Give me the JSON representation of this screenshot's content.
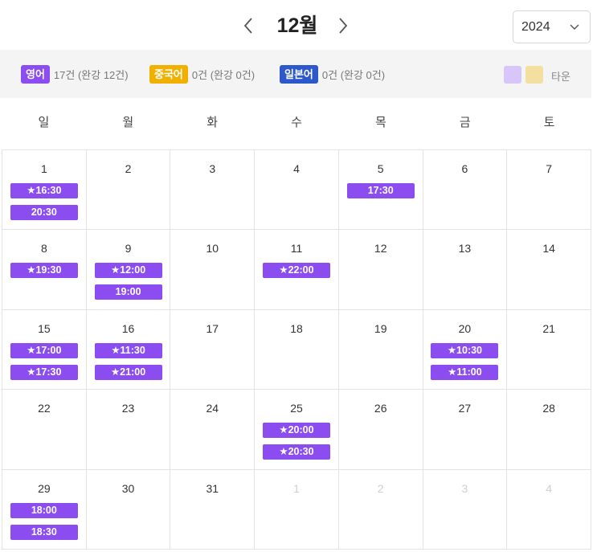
{
  "header": {
    "month": "12월",
    "year": "2024"
  },
  "colors": {
    "english": "#8b4cf0",
    "chinese": "#f0b000",
    "japanese": "#2d58cc",
    "town_light_purple": "#d8c6fb",
    "town_light_yellow": "#f3dfa0"
  },
  "legend": [
    {
      "badge": "영어",
      "count": "17건 (완강 12건)",
      "color": "#8b4cf0"
    },
    {
      "badge": "중국어",
      "count": "0건 (완강 0건)",
      "color": "#f0b000"
    },
    {
      "badge": "일본어",
      "count": "0건 (완강 0건)",
      "color": "#2d58cc"
    }
  ],
  "town_label": "타운",
  "weekdays": [
    "일",
    "월",
    "화",
    "수",
    "목",
    "금",
    "토"
  ],
  "days": [
    {
      "day": "1",
      "slots": [
        "★16:30",
        "20:30"
      ]
    },
    {
      "day": "2",
      "slots": []
    },
    {
      "day": "3",
      "slots": []
    },
    {
      "day": "4",
      "slots": []
    },
    {
      "day": "5",
      "slots": [
        "17:30"
      ]
    },
    {
      "day": "6",
      "slots": []
    },
    {
      "day": "7",
      "slots": []
    },
    {
      "day": "8",
      "slots": [
        "★19:30"
      ]
    },
    {
      "day": "9",
      "slots": [
        "★12:00",
        "19:00"
      ]
    },
    {
      "day": "10",
      "slots": []
    },
    {
      "day": "11",
      "slots": [
        "★22:00"
      ]
    },
    {
      "day": "12",
      "slots": []
    },
    {
      "day": "13",
      "slots": []
    },
    {
      "day": "14",
      "slots": []
    },
    {
      "day": "15",
      "slots": [
        "★17:00",
        "★17:30"
      ]
    },
    {
      "day": "16",
      "slots": [
        "★11:30",
        "★21:00"
      ]
    },
    {
      "day": "17",
      "slots": []
    },
    {
      "day": "18",
      "slots": []
    },
    {
      "day": "19",
      "slots": []
    },
    {
      "day": "20",
      "slots": [
        "★10:30",
        "★11:00"
      ]
    },
    {
      "day": "21",
      "slots": []
    },
    {
      "day": "22",
      "slots": []
    },
    {
      "day": "23",
      "slots": []
    },
    {
      "day": "24",
      "slots": []
    },
    {
      "day": "25",
      "slots": [
        "★20:00",
        "★20:30"
      ]
    },
    {
      "day": "26",
      "slots": []
    },
    {
      "day": "27",
      "slots": []
    },
    {
      "day": "28",
      "slots": []
    },
    {
      "day": "29",
      "slots": [
        "18:00",
        "18:30"
      ]
    },
    {
      "day": "30",
      "slots": []
    },
    {
      "day": "31",
      "slots": []
    },
    {
      "day": "1",
      "slots": [],
      "other_month": true
    },
    {
      "day": "2",
      "slots": [],
      "other_month": true
    },
    {
      "day": "3",
      "slots": [],
      "other_month": true
    },
    {
      "day": "4",
      "slots": [],
      "other_month": true
    }
  ]
}
